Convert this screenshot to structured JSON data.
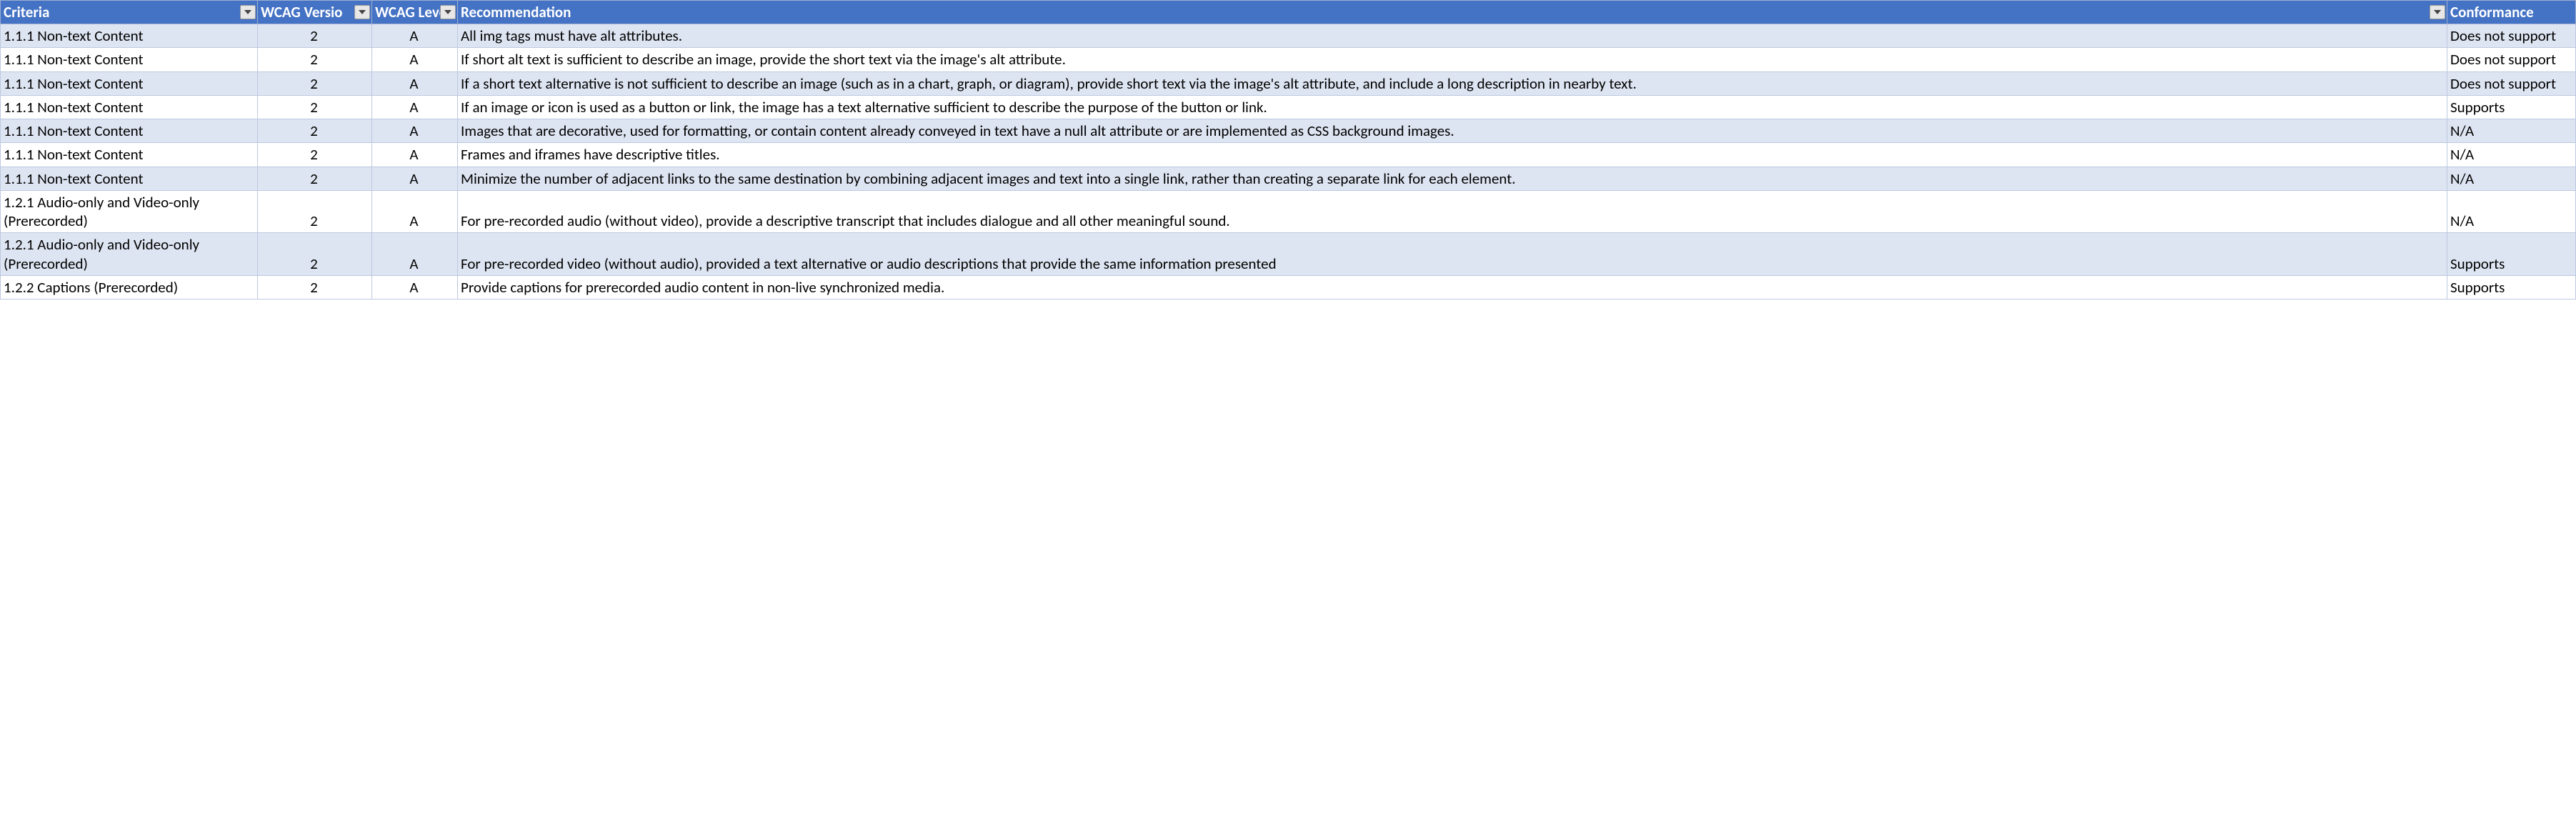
{
  "headers": {
    "criteria": "Criteria",
    "version": "WCAG Versio",
    "level": "WCAG Leve",
    "recommendation": "Recommendation",
    "conformance": "Conformance"
  },
  "rows": [
    {
      "band": true,
      "criteria": "1.1.1 Non-text Content",
      "version": "2",
      "level": "A",
      "recommendation": "All img tags must have alt attributes.",
      "conformance": "Does not support"
    },
    {
      "band": false,
      "criteria": "1.1.1 Non-text Content",
      "version": "2",
      "level": "A",
      "recommendation": "If short alt text is sufficient to describe an image, provide the short text via the image's alt attribute.",
      "conformance": "Does not support"
    },
    {
      "band": true,
      "criteria": "1.1.1 Non-text Content",
      "version": "2",
      "level": "A",
      "recommendation": "If a short text alternative is not sufficient to describe an image (such as in a chart, graph, or diagram), provide short text via the image's alt attribute, and include a long description in nearby text.",
      "conformance": "Does not support"
    },
    {
      "band": false,
      "criteria": "1.1.1 Non-text Content",
      "version": "2",
      "level": "A",
      "recommendation": "If an image or icon is used as a button or link, the image has a text alternative sufficient to describe the purpose of the button or link.",
      "conformance": "Supports"
    },
    {
      "band": true,
      "criteria": "1.1.1 Non-text Content",
      "version": "2",
      "level": "A",
      "recommendation": "Images that are decorative, used for formatting, or contain content already conveyed in text have a null alt attribute or are implemented as CSS background images.",
      "conformance": "N/A"
    },
    {
      "band": false,
      "criteria": "1.1.1 Non-text Content",
      "version": "2",
      "level": "A",
      "recommendation": "Frames and iframes have descriptive titles.",
      "conformance": "N/A"
    },
    {
      "band": true,
      "criteria": "1.1.1 Non-text Content",
      "version": "2",
      "level": "A",
      "recommendation": "Minimize the number of adjacent links to the same destination by combining adjacent images and text into a single link, rather than creating a separate link for each element.",
      "conformance": "N/A"
    },
    {
      "band": false,
      "criteria": "1.2.1 Audio-only and Video-only (Prerecorded)",
      "version": "2",
      "level": "A",
      "recommendation": "For pre-recorded audio (without video), provide a descriptive transcript that includes dialogue and all other meaningful sound.",
      "conformance": "N/A"
    },
    {
      "band": true,
      "criteria": "1.2.1 Audio-only and Video-only (Prerecorded)",
      "version": "2",
      "level": "A",
      "recommendation": "For pre-recorded video (without audio), provided a text alternative or audio descriptions that provide the same information presented",
      "conformance": "Supports"
    },
    {
      "band": false,
      "criteria": "1.2.2 Captions (Prerecorded)",
      "version": "2",
      "level": "A",
      "recommendation": "Provide captions for prerecorded audio content in non-live synchronized media.",
      "conformance": "Supports"
    }
  ]
}
